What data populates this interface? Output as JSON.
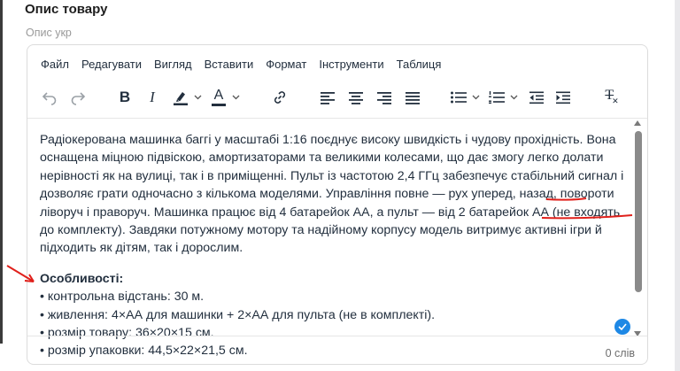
{
  "section": {
    "title": "Опис товару",
    "field_label": "Опис укр"
  },
  "menubar": [
    "Файл",
    "Редагувати",
    "Вигляд",
    "Вставити",
    "Формат",
    "Інструменти",
    "Таблиця"
  ],
  "toolbar": {
    "icons": [
      "undo-icon",
      "redo-icon",
      "bold-icon",
      "italic-icon",
      "highlight-color-icon",
      "text-color-icon",
      "link-icon",
      "align-left-icon",
      "align-center-icon",
      "align-right-icon",
      "align-justify-icon",
      "bullet-list-icon",
      "numbered-list-icon",
      "outdent-icon",
      "indent-icon",
      "clear-formatting-icon"
    ],
    "bold_label": "B",
    "italic_label": "I",
    "text_color_label": "A",
    "clear_format_label": "T"
  },
  "content": {
    "paragraph": {
      "part1": "Радіокерована машинка баггі у масштабі 1:16 поєднує високу швидкість і чудову прохідність. Вона оснащена міцною підвіскою, амортизаторами та великими колесами, що дає змогу легко долати нерівності як на вулиці, так і в приміщенні. Пульт із частотою 2,4 ГГц забезпечує стабільний сигнал і дозволяє грати одночасно з кількома моделями. Управління повне",
      "dash1": " — ",
      "part2": "рух уперед, назад, повороти ліворуч і праворуч. Машинка працює від 4 батарейок АА, а пульт",
      "dash2": " — ",
      "part3": "від 2 батарейок АА (не входять до комплекту). Завдяки потужному мотору та надійному корпусу модель витримує активні ігри й підходить як дітям, так і дорослим."
    },
    "features_heading": "Особливості:",
    "features": [
      "• контрольна відстань: 30 м.",
      "• живлення: 4×АА для машинки + 2×АА для пульта (не в комплекті).",
      "• розмір товару: 36×20×15 см.",
      "• розмір упаковки: 44,5×22×21,5 см."
    ]
  },
  "status": {
    "word_count": "0 слів"
  },
  "colors": {
    "accent": "#1e88e5",
    "annotation": "#e0201b",
    "text": "#222f3e"
  }
}
